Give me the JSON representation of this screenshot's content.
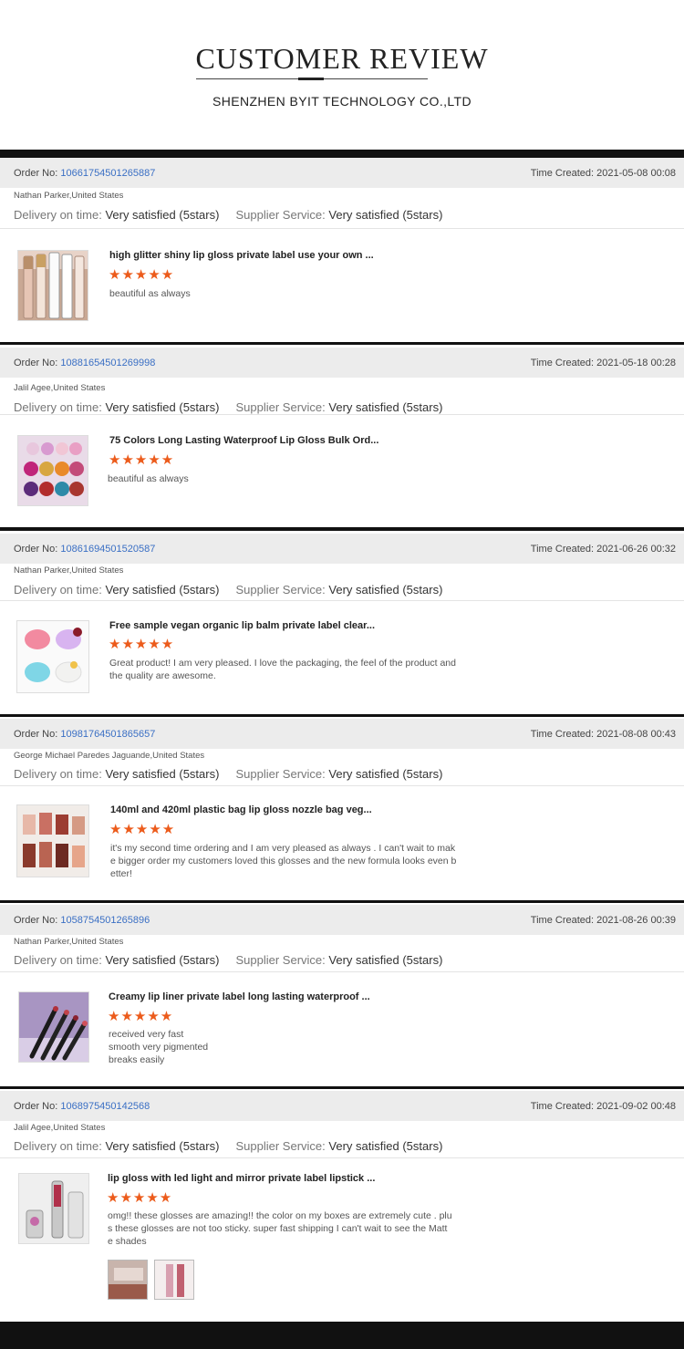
{
  "header": {
    "title": "CUSTOMER REVIEW",
    "subtitle": "SHENZHEN BYIT TECHNOLOGY CO.,LTD"
  },
  "labels": {
    "order_no": "Order No:",
    "time_created": "Time Created:",
    "delivery": "Delivery on time:",
    "supplier": "Supplier Service:"
  },
  "reviews": [
    {
      "order_no": "10661754501265887",
      "time": "2021-05-08 00:08",
      "buyer": "Nathan Parker,United States",
      "delivery_value": "Very satisfied (5stars)",
      "supplier_value": "Very satisfied (5stars)",
      "product": "high glitter shiny lip gloss private label use your own ...",
      "stars": "★★★★★",
      "comment": "beautiful as always"
    },
    {
      "order_no": "10881654501269998",
      "time": "2021-05-18 00:28",
      "buyer": "Jalil Agee,United States",
      "delivery_value": "Very satisfied (5stars)",
      "supplier_value": "Very satisfied (5stars)",
      "product": "75 Colors Long Lasting Waterproof Lip Gloss Bulk Ord...",
      "stars": "★★★★★",
      "comment": "beautiful as always"
    },
    {
      "order_no": "10861694501520587",
      "time": "2021-06-26 00:32",
      "buyer": "Nathan Parker,United States",
      "delivery_value": "Very satisfied (5stars)",
      "supplier_value": "Very satisfied (5stars)",
      "product": "Free sample vegan organic lip balm private label clear...",
      "stars": "★★★★★",
      "comment": "Great product! I am very pleased. I love the packaging, the feel of the product and\nthe quality are awesome."
    },
    {
      "order_no": "10981764501865657",
      "time": "2021-08-08 00:43",
      "buyer": "George Michael Paredes Jaguande,United States",
      "delivery_value": "Very satisfied (5stars)",
      "supplier_value": "Very satisfied (5stars)",
      "product": "140ml and 420ml plastic bag lip gloss nozzle bag veg...",
      "stars": "★★★★★",
      "comment": "it's my second time ordering and I am very pleased as always . I can't wait to mak\ne bigger order my customers loved this glosses and the new formula looks even b\netter!"
    },
    {
      "order_no": "1058754501265896",
      "time": "2021-08-26 00:39",
      "buyer": "Nathan Parker,United States",
      "delivery_value": "Very satisfied (5stars)",
      "supplier_value": "Very satisfied (5stars)",
      "product": "Creamy lip liner private label long lasting waterproof ...",
      "stars": "★★★★★",
      "comment": "received very fast\nsmooth very pigmented\nbreaks easily"
    },
    {
      "order_no": "1068975450142568",
      "time": "2021-09-02 00:48",
      "buyer": "Jalil Agee,United States",
      "delivery_value": "Very satisfied (5stars)",
      "supplier_value": "Very satisfied (5stars)",
      "product": "lip gloss with led light and mirror private label lipstick ...",
      "stars": "★★★★★",
      "comment": "omg!! these glosses are amazing!! the color  on my boxes are extremely cute . plu\ns these glosses are not too sticky.  super fast shipping I can't wait to see the Matt\ne shades"
    }
  ],
  "colors": {
    "star": "#ec5b1b",
    "order_link": "#3a6fc4",
    "band": "#111111"
  }
}
